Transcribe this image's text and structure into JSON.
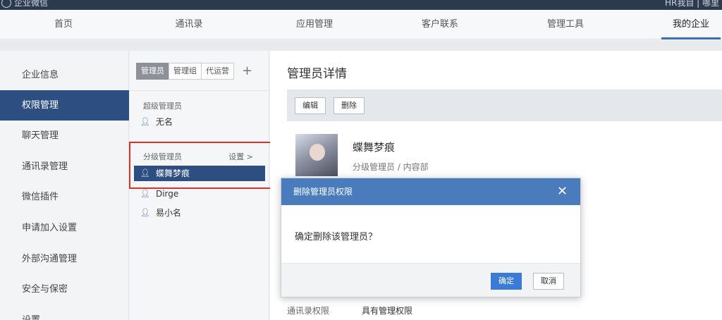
{
  "topbar": {
    "app_title": "企业微信",
    "right_text": "HR我自 | 哪里"
  },
  "nav": {
    "items": [
      "首页",
      "通讯录",
      "应用管理",
      "客户联系",
      "管理工具",
      "我的企业"
    ],
    "active": "我的企业"
  },
  "sidebar": {
    "items": [
      "企业信息",
      "权限管理",
      "聊天管理",
      "通讯录管理",
      "微信插件",
      "申请加入设置",
      "外部沟通管理",
      "安全与保密",
      "设置"
    ],
    "active": "权限管理"
  },
  "admin_list": {
    "tabs": [
      "管理员",
      "管理组",
      "代运营"
    ],
    "add_label": "+",
    "super_label": "超级管理员",
    "super_members": [
      "无名"
    ],
    "sub_label": "分级管理员",
    "sub_settings": "设置 >",
    "sub_members": [
      "蝶舞梦痕",
      "Dirge",
      "易小名"
    ],
    "selected": "蝶舞梦痕"
  },
  "detail": {
    "title": "管理员详情",
    "edit_label": "编辑",
    "delete_label": "删除",
    "name": "蝶舞梦痕",
    "role": "分级管理员 / 内容部",
    "perm_label": "通讯录权限",
    "perm_value": "具有管理权限"
  },
  "modal": {
    "title": "删除管理员权限",
    "close": "✕",
    "message": "确定删除该管理员？",
    "ok_label": "确定",
    "cancel_label": "取消"
  },
  "colors": {
    "accent": "#3a7bd5",
    "sidebar_active": "#2d4e80",
    "highlight": "#e0322c"
  }
}
